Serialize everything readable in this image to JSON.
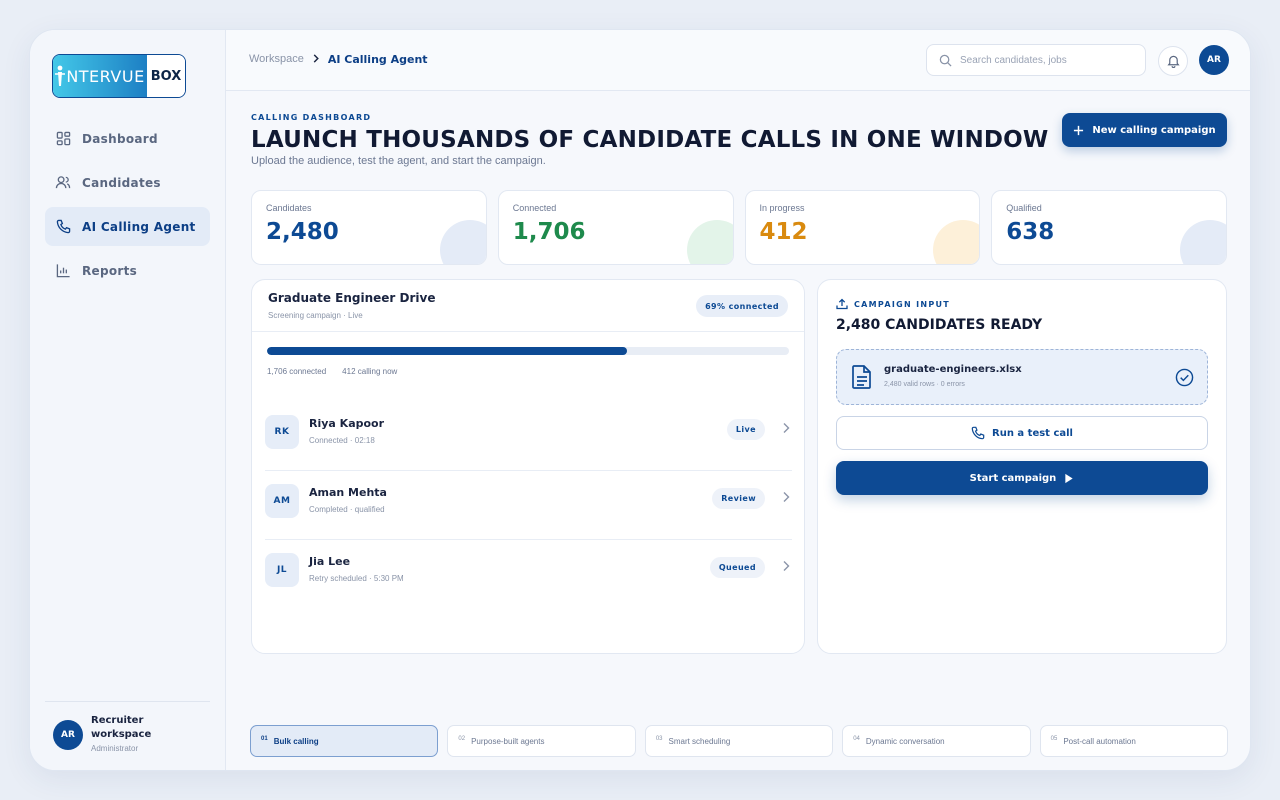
{
  "brand": {
    "logo_left": "NTERVUE",
    "logo_right": "BOX"
  },
  "sidebar": {
    "items": [
      {
        "label": "Dashboard",
        "icon": "grid-icon",
        "active": false
      },
      {
        "label": "Candidates",
        "icon": "users-icon",
        "active": false
      },
      {
        "label": "AI Calling Agent",
        "icon": "phone-icon",
        "active": true
      },
      {
        "label": "Reports",
        "icon": "bar-chart-icon",
        "active": false
      }
    ],
    "footer": {
      "initials": "AR",
      "title_line1": "Recruiter",
      "title_line2": "workspace",
      "role": "Administrator"
    }
  },
  "topbar": {
    "breadcrumb_root": "Workspace",
    "breadcrumb_current": "AI Calling Agent",
    "search_placeholder": "Search candidates, jobs",
    "avatar_initials": "AR"
  },
  "header": {
    "eyebrow": "CALLING DASHBOARD",
    "title": "LAUNCH THOUSANDS OF CANDIDATE CALLS IN ONE WINDOW",
    "subtitle": "Upload the audience, test the agent, and start the campaign.",
    "new_campaign_label": "New calling campaign"
  },
  "stats": [
    {
      "label": "Candidates",
      "value": "2,480",
      "color": "#0d4a94",
      "blob": "#e4ebf7"
    },
    {
      "label": "Connected",
      "value": "1,706",
      "color": "#1e8a4c",
      "blob": "#e3f4e9"
    },
    {
      "label": "In progress",
      "value": "412",
      "color": "#d98a0f",
      "blob": "#fdf0d9"
    },
    {
      "label": "Qualified",
      "value": "638",
      "color": "#0d4a94",
      "blob": "#e4ebf7"
    }
  ],
  "campaign": {
    "title": "Graduate Engineer Drive",
    "subtitle": "Screening campaign · Live",
    "pill": "69% connected",
    "progress": 0.69,
    "connected_label": "1,706 connected",
    "calling_label": "412 calling now",
    "rows": [
      {
        "initials": "RK",
        "name": "Riya Kapoor",
        "meta": "Connected · 02:18",
        "badge": "Live"
      },
      {
        "initials": "AM",
        "name": "Aman Mehta",
        "meta": "Completed · qualified",
        "badge": "Review"
      },
      {
        "initials": "JL",
        "name": "Jia Lee",
        "meta": "Retry scheduled · 5:30 PM",
        "badge": "Queued"
      }
    ]
  },
  "input": {
    "eyebrow": "CAMPAIGN INPUT",
    "title": "2,480 CANDIDATES READY",
    "file_name": "graduate-engineers.xlsx",
    "file_meta": "2,480 valid rows · 0 errors",
    "test_label": "Run a test call",
    "start_label": "Start campaign"
  },
  "steps": [
    {
      "num": "01",
      "label": "Bulk calling",
      "active": true
    },
    {
      "num": "02",
      "label": "Purpose-built agents",
      "active": false
    },
    {
      "num": "03",
      "label": "Smart scheduling",
      "active": false
    },
    {
      "num": "04",
      "label": "Dynamic conversation",
      "active": false
    },
    {
      "num": "05",
      "label": "Post-call automation",
      "active": false
    }
  ]
}
